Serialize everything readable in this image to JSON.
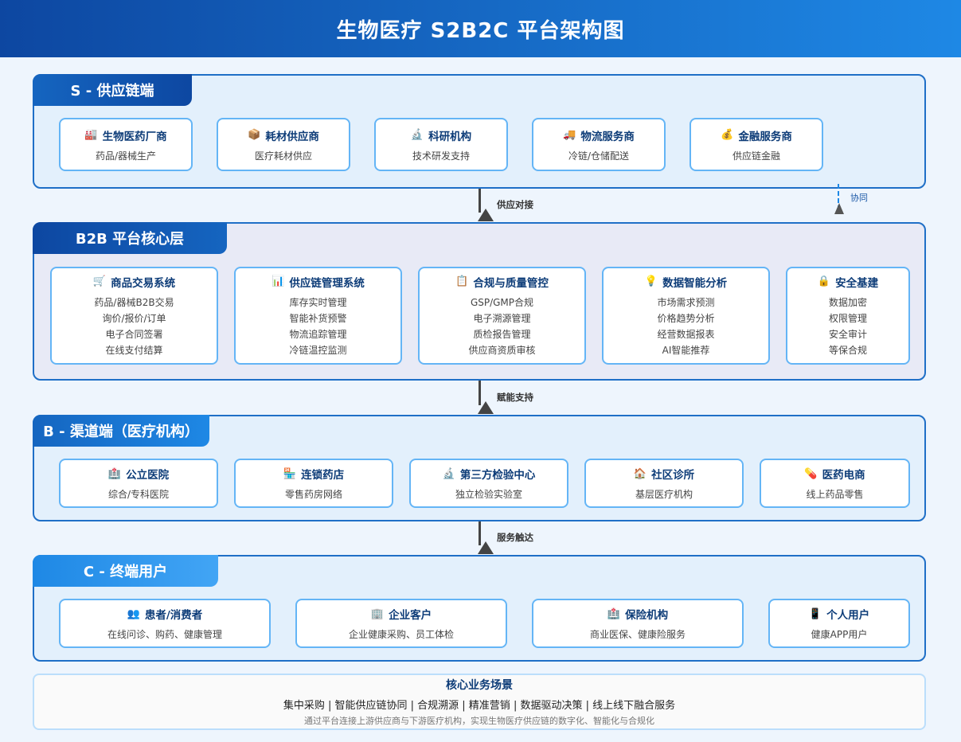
{
  "header": {
    "title": "生物医疗 S2B2C 平台架构图"
  },
  "layers": {
    "s": {
      "title": "S - 供应链端",
      "cards": [
        {
          "icon": "factory-icon",
          "glyph": "🏭",
          "title": "生物医药厂商",
          "sub": "药品/器械生产"
        },
        {
          "icon": "package-icon",
          "glyph": "📦",
          "title": "耗材供应商",
          "sub": "医疗耗材供应"
        },
        {
          "icon": "microscope-icon",
          "glyph": "🔬",
          "title": "科研机构",
          "sub": "技术研发支持"
        },
        {
          "icon": "truck-icon",
          "glyph": "🚚",
          "title": "物流服务商",
          "sub": "冷链/仓储配送"
        },
        {
          "icon": "money-bag-icon",
          "glyph": "💰",
          "title": "金融服务商",
          "sub": "供应链金融"
        }
      ]
    },
    "b2b": {
      "title": "B2B 平台核心层",
      "cards": [
        {
          "icon": "cart-icon",
          "glyph": "🛒",
          "title": "商品交易系统",
          "items": [
            "药品/器械B2B交易",
            "询价/报价/订单",
            "电子合同签署",
            "在线支付结算"
          ]
        },
        {
          "icon": "bar-chart-icon",
          "glyph": "📊",
          "title": "供应链管理系统",
          "items": [
            "库存实时管理",
            "智能补货预警",
            "物流追踪管理",
            "冷链温控监测"
          ]
        },
        {
          "icon": "clipboard-icon",
          "glyph": "📋",
          "title": "合规与质量管控",
          "items": [
            "GSP/GMP合规",
            "电子溯源管理",
            "质检报告管理",
            "供应商资质审核"
          ]
        },
        {
          "icon": "lightbulb-icon",
          "glyph": "💡",
          "title": "数据智能分析",
          "items": [
            "市场需求预测",
            "价格趋势分析",
            "经营数据报表",
            "AI智能推荐"
          ]
        },
        {
          "icon": "lock-icon",
          "glyph": "🔒",
          "title": "安全基建",
          "items": [
            "数据加密",
            "权限管理",
            "安全审计",
            "等保合规"
          ]
        }
      ]
    },
    "b": {
      "title": "B - 渠道端（医疗机构）",
      "cards": [
        {
          "icon": "hospital-icon",
          "glyph": "🏥",
          "title": "公立医院",
          "sub": "综合/专科医院"
        },
        {
          "icon": "store-icon",
          "glyph": "🏪",
          "title": "连锁药店",
          "sub": "零售药房网络"
        },
        {
          "icon": "microscope-icon",
          "glyph": "🔬",
          "title": "第三方检验中心",
          "sub": "独立检验实验室"
        },
        {
          "icon": "house-icon",
          "glyph": "🏠",
          "title": "社区诊所",
          "sub": "基层医疗机构"
        },
        {
          "icon": "pill-icon",
          "glyph": "💊",
          "title": "医药电商",
          "sub": "线上药品零售"
        }
      ]
    },
    "c": {
      "title": "C - 终端用户",
      "cards": [
        {
          "icon": "people-icon",
          "glyph": "👥",
          "title": "患者/消费者",
          "sub": "在线问诊、购药、健康管理"
        },
        {
          "icon": "office-building-icon",
          "glyph": "🏢",
          "title": "企业客户",
          "sub": "企业健康采购、员工体检"
        },
        {
          "icon": "hospital-icon",
          "glyph": "🏥",
          "title": "保险机构",
          "sub": "商业医保、健康险服务"
        },
        {
          "icon": "phone-icon",
          "glyph": "📱",
          "title": "个人用户",
          "sub": "健康APP用户"
        }
      ]
    }
  },
  "connectors": {
    "supply": "供应对接",
    "enable": "赋能支持",
    "service": "服务触达",
    "collab": "协同"
  },
  "scenario": {
    "title": "核心业务场景",
    "line": "集中采购 | 智能供应链协同 | 合规溯源 | 精准营销 | 数据驱动决策 | 线上线下融合服务",
    "desc": "通过平台连接上游供应商与下游医疗机构，实现生物医疗供应链的数字化、智能化与合规化"
  }
}
